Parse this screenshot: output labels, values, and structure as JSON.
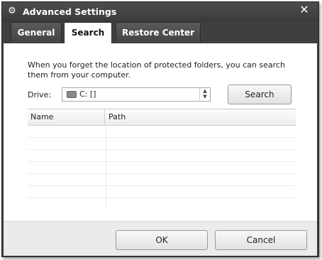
{
  "window": {
    "title": "Advanced Settings",
    "close_glyph": "✕"
  },
  "tabs": [
    {
      "label": "General",
      "active": false
    },
    {
      "label": "Search",
      "active": true
    },
    {
      "label": "Restore Center",
      "active": false
    }
  ],
  "search": {
    "description": "When you forget the location of protected folders, you can search them from your computer.",
    "drive_label": "Drive:",
    "drive_value": "C: []",
    "search_button": "Search"
  },
  "table": {
    "columns": [
      "Name",
      "Path"
    ],
    "rows": []
  },
  "footer": {
    "ok": "OK",
    "cancel": "Cancel"
  },
  "icons": {
    "title": "gear-icon",
    "drive": "drive-icon",
    "close": "close-icon"
  }
}
